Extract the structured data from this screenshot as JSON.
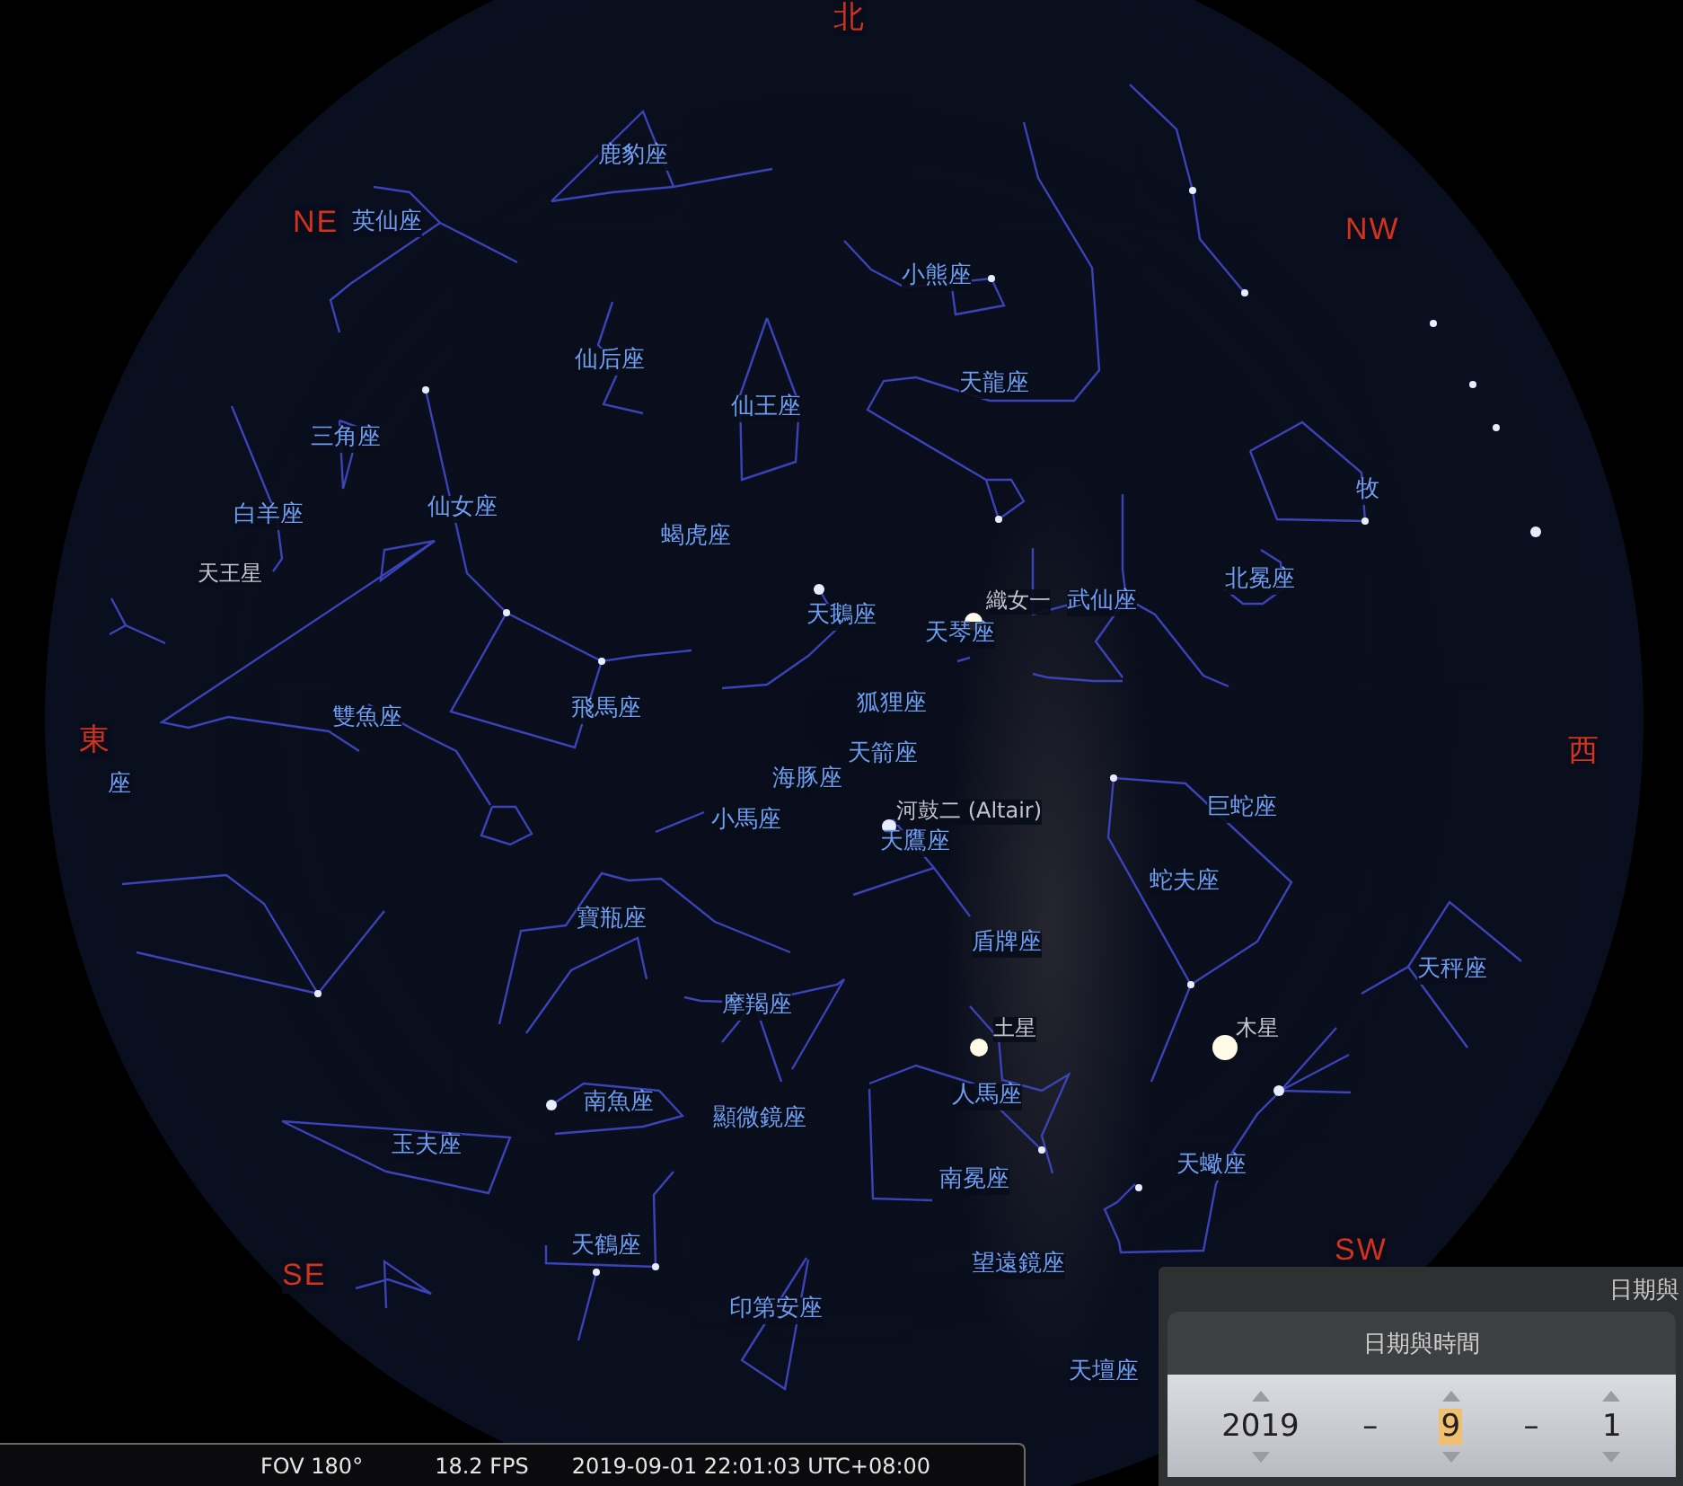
{
  "sky": {
    "labels": [
      {
        "kind": "cardinal",
        "text": "北"
      },
      {
        "kind": "cardinal",
        "text": "NE"
      },
      {
        "kind": "constellation",
        "text": "英仙座"
      },
      {
        "kind": "constellation",
        "text": "鹿豹座"
      },
      {
        "kind": "constellation",
        "text": "小熊座"
      },
      {
        "kind": "cardinal",
        "text": "NW"
      },
      {
        "kind": "constellation",
        "text": "仙后座"
      },
      {
        "kind": "constellation",
        "text": "天龍座"
      },
      {
        "kind": "constellation",
        "text": "仙王座"
      },
      {
        "kind": "constellation",
        "text": "三角座"
      },
      {
        "kind": "constellation",
        "text": "仙女座"
      },
      {
        "kind": "constellation",
        "text": "牧"
      },
      {
        "kind": "constellation",
        "text": "白羊座"
      },
      {
        "kind": "constellation",
        "text": "蝎虎座"
      },
      {
        "kind": "object",
        "text": "天王星"
      },
      {
        "kind": "constellation",
        "text": "北冕座"
      },
      {
        "kind": "object",
        "text": "織女一"
      },
      {
        "kind": "constellation",
        "text": "武仙座"
      },
      {
        "kind": "constellation",
        "text": "天鵝座"
      },
      {
        "kind": "constellation",
        "text": "天琴座"
      },
      {
        "kind": "constellation",
        "text": "狐狸座"
      },
      {
        "kind": "constellation",
        "text": "雙魚座"
      },
      {
        "kind": "constellation",
        "text": "飛馬座"
      },
      {
        "kind": "cardinal",
        "text": "東"
      },
      {
        "kind": "constellation",
        "text": "天箭座"
      },
      {
        "kind": "cardinal",
        "text": "西"
      },
      {
        "kind": "constellation",
        "text": "海豚座"
      },
      {
        "kind": "constellation",
        "text": "座"
      },
      {
        "kind": "object",
        "text": "河鼓二 (Altair)"
      },
      {
        "kind": "constellation",
        "text": "巨蛇座"
      },
      {
        "kind": "constellation",
        "text": "小馬座"
      },
      {
        "kind": "constellation",
        "text": "天鷹座"
      },
      {
        "kind": "constellation",
        "text": "蛇夫座"
      },
      {
        "kind": "constellation",
        "text": "寶瓶座"
      },
      {
        "kind": "constellation",
        "text": "盾牌座"
      },
      {
        "kind": "constellation",
        "text": "天秤座"
      },
      {
        "kind": "constellation",
        "text": "摩羯座"
      },
      {
        "kind": "object",
        "text": "土星"
      },
      {
        "kind": "object",
        "text": "木星"
      },
      {
        "kind": "constellation",
        "text": "人馬座"
      },
      {
        "kind": "constellation",
        "text": "南魚座"
      },
      {
        "kind": "constellation",
        "text": "顯微鏡座"
      },
      {
        "kind": "constellation",
        "text": "玉夫座"
      },
      {
        "kind": "constellation",
        "text": "天蠍座"
      },
      {
        "kind": "constellation",
        "text": "南冕座"
      },
      {
        "kind": "constellation",
        "text": "天鶴座"
      },
      {
        "kind": "constellation",
        "text": "望遠鏡座"
      },
      {
        "kind": "cardinal",
        "text": "SE"
      },
      {
        "kind": "cardinal",
        "text": "SW"
      },
      {
        "kind": "constellation",
        "text": "印第安座"
      },
      {
        "kind": "constellation",
        "text": "天壇座"
      }
    ]
  },
  "status_bar": {
    "fov": "FOV 180°",
    "fps": "18.2 FPS",
    "datetime": "2019-09-01 22:01:03 UTC+08:00"
  },
  "date_time_window": {
    "title": "日期與",
    "dialog_title": "日期與時間",
    "fields": [
      {
        "value": "2019",
        "selected": false
      },
      {
        "value": "9",
        "selected": true
      },
      {
        "value": "1",
        "selected": false
      }
    ],
    "separators": [
      "–",
      "–"
    ]
  }
}
